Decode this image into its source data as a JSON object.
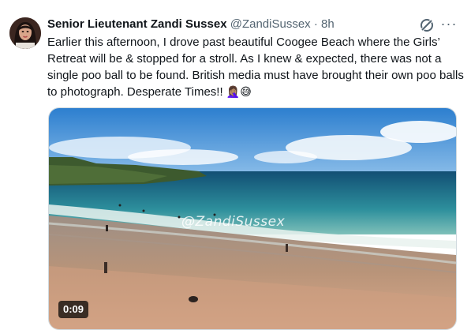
{
  "tweet": {
    "author_name": "Senior Lieutenant Zandi Sussex",
    "handle": "@ZandiSussex",
    "separator": "·",
    "time": "8h",
    "more_label": "···",
    "text": "Earlier this afternoon, I drove past beautiful Coogee Beach where the Girls’ Retreat will be & stopped for a stroll. As I knew & expected, there was not a single poo ball to be found. British media must have brought their own poo balls to photograph. Desperate Times!!",
    "emojis": "🤦🏽‍♀️😅"
  },
  "media": {
    "watermark": "@ZandiSussex",
    "duration": "0:09"
  },
  "icons": [
    "grok-icon",
    "more-icon",
    "avatar"
  ],
  "colors": {
    "text": "#0f1419",
    "secondary": "#536471",
    "border": "#cfd9de",
    "sky": "#3f8fd6",
    "ocean": "#1e6f8c",
    "sand": "#b8927a"
  }
}
